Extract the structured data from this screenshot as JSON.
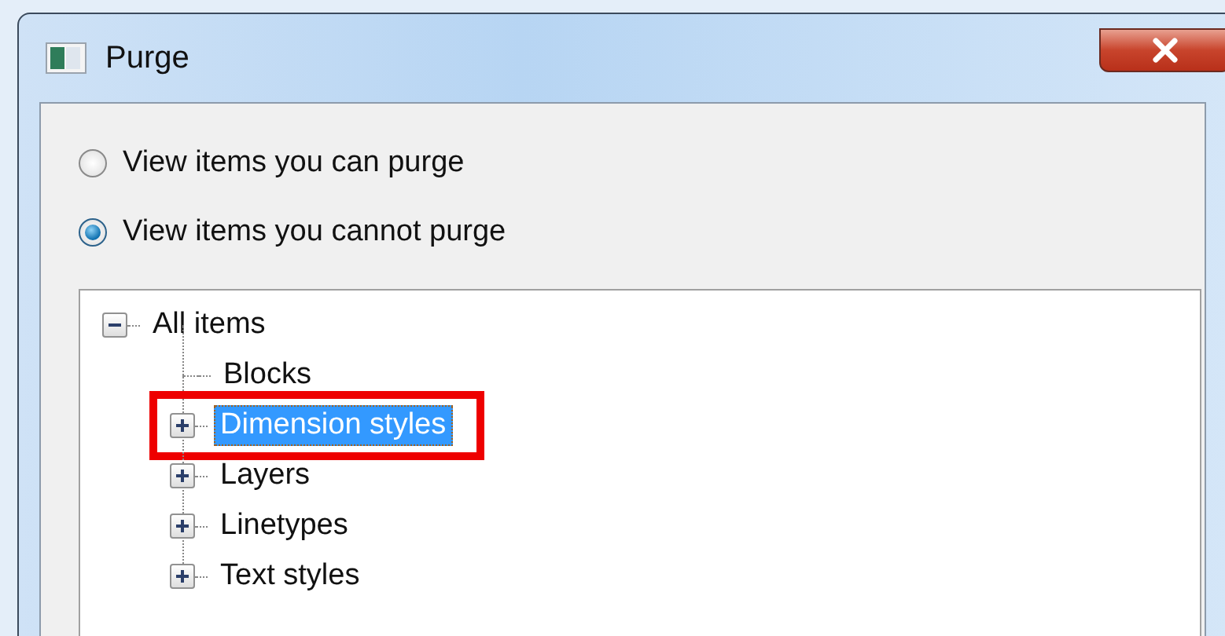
{
  "window": {
    "title": "Purge"
  },
  "view_options": [
    {
      "label": "View items you can purge",
      "selected": false
    },
    {
      "label": "View items you cannot purge",
      "selected": true
    }
  ],
  "tree": [
    {
      "label": "All items",
      "expanded": true,
      "selected": false,
      "children": [
        {
          "label": "Blocks",
          "expandable": false,
          "selected": false
        },
        {
          "label": "Dimension styles",
          "expandable": true,
          "selected": true,
          "highlighted": true
        },
        {
          "label": "Layers",
          "expandable": true,
          "selected": false
        },
        {
          "label": "Linetypes",
          "expandable": true,
          "selected": false
        },
        {
          "label": "Text styles",
          "expandable": true,
          "selected": false
        }
      ]
    }
  ]
}
